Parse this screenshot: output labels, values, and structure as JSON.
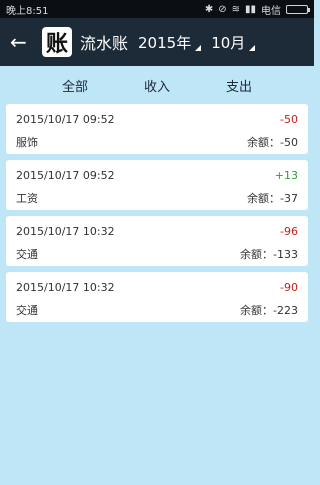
{
  "status": {
    "time": "晚上8:51",
    "carrier": "电信"
  },
  "header": {
    "back": "←",
    "logo": "账",
    "title": "流水账",
    "year": "2015年",
    "month": "10月"
  },
  "tabs": [
    {
      "label": "全部"
    },
    {
      "label": "收入"
    },
    {
      "label": "支出"
    }
  ],
  "entries": [
    {
      "date": "2015/10/17 09:52",
      "amount": "-50",
      "category": "服饰",
      "balance": "余额：-50"
    },
    {
      "date": "2015/10/17 09:52",
      "amount": "+13",
      "category": "工资",
      "balance": "余额：-37"
    },
    {
      "date": "2015/10/17 10:32",
      "amount": "-96",
      "category": "交通",
      "balance": "余额：-133"
    },
    {
      "date": "2015/10/17 10:32",
      "amount": "-90",
      "category": "交通",
      "balance": "余额：-223"
    }
  ]
}
